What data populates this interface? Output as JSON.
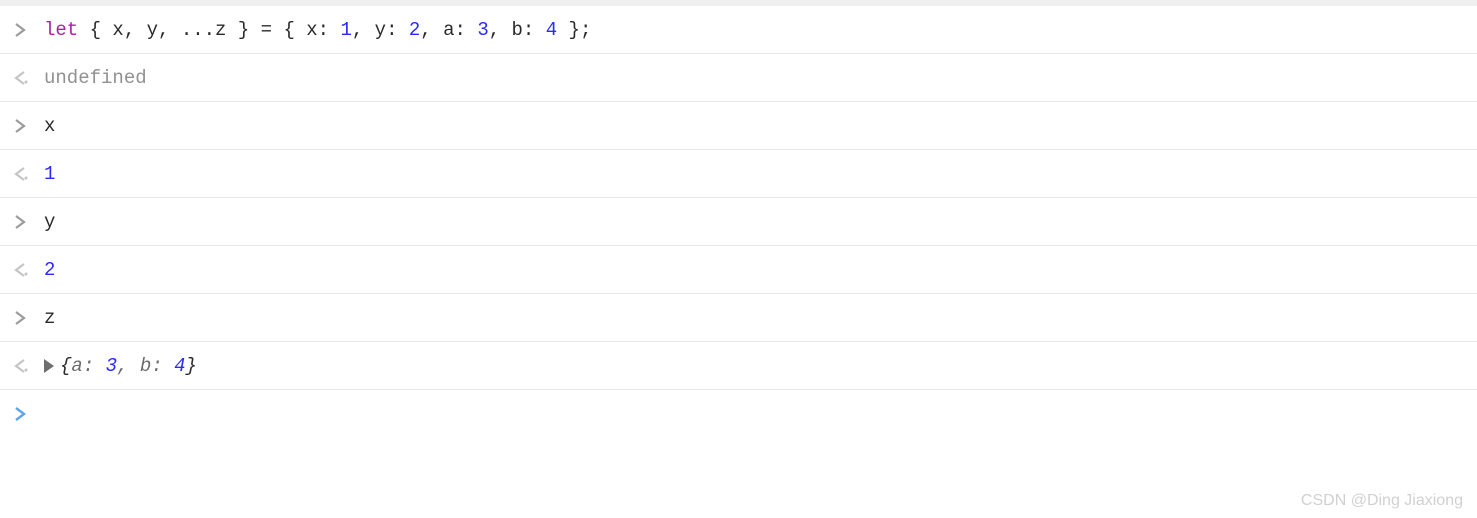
{
  "rows": {
    "r0": {
      "tokens": {
        "kw": "let",
        "lhs": " { x, y, ...z } = { x: ",
        "n1": "1",
        "c1": ", y: ",
        "n2": "2",
        "c2": ", a: ",
        "n3": "3",
        "c3": ", b: ",
        "n4": "4",
        "tail": " };"
      }
    },
    "r1": {
      "text": "undefined"
    },
    "r2": {
      "text": "x"
    },
    "r3": {
      "text": "1"
    },
    "r4": {
      "text": "y"
    },
    "r5": {
      "text": "2"
    },
    "r6": {
      "text": "z"
    },
    "r7": {
      "obj": {
        "open": "{",
        "k1": "a",
        "sep1": ": ",
        "v1": "3",
        "com": ", ",
        "k2": "b",
        "sep2": ": ",
        "v2": "4",
        "close": "}"
      }
    }
  },
  "watermark": "CSDN @Ding Jiaxiong"
}
